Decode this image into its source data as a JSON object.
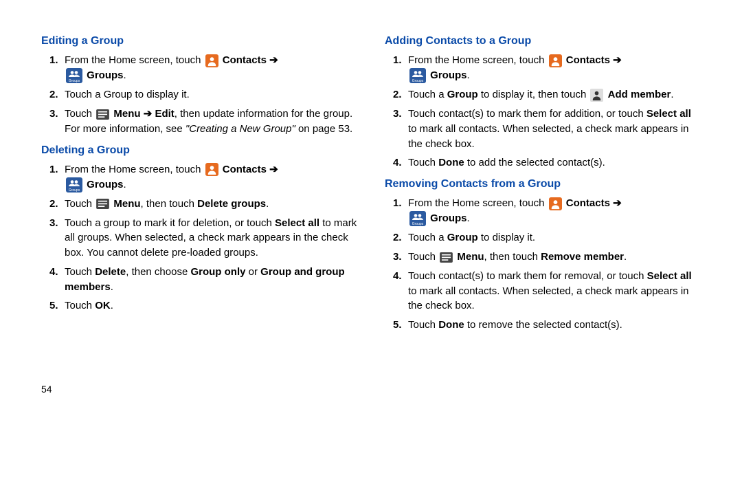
{
  "page_number": "54",
  "left": {
    "section1": {
      "heading": "Editing a Group",
      "step1_a": "From the Home screen, touch ",
      "step1_contacts": "Contacts",
      "step1_groups": "Groups",
      "step1_dot": ".",
      "step2": "Touch a Group to display it.",
      "step3_a": "Touch ",
      "step3_menu": "Menu",
      "step3_b": " ➔ ",
      "step3_edit": "Edit",
      "step3_c": ", then update information for the group. For more information, see ",
      "step3_ref": "\"Creating a New Group\"",
      "step3_d": " on page 53."
    },
    "section2": {
      "heading": "Deleting a Group",
      "step1_a": "From the Home screen, touch ",
      "step1_contacts": "Contacts",
      "step1_groups": "Groups",
      "step1_dot": ".",
      "step2_a": "Touch ",
      "step2_menu": "Menu",
      "step2_b": ", then touch ",
      "step2_del": "Delete groups",
      "step2_dot": ".",
      "step3_a": "Touch a group to mark it for deletion, or touch ",
      "step3_selall": "Select all",
      "step3_b": " to mark all groups. When selected, a check mark appears in the check box. You cannot delete pre-loaded groups.",
      "step4_a": "Touch ",
      "step4_del": "Delete",
      "step4_b": ", then choose ",
      "step4_go": "Group only",
      "step4_c": " or ",
      "step4_gm": "Group and group members",
      "step4_dot": ".",
      "step5_a": "Touch ",
      "step5_ok": "OK",
      "step5_dot": "."
    }
  },
  "right": {
    "section1": {
      "heading": "Adding Contacts to a Group",
      "step1_a": "From the Home screen, touch ",
      "step1_contacts": "Contacts",
      "step1_groups": "Groups",
      "step1_dot": ".",
      "step2_a": "Touch a ",
      "step2_group": "Group",
      "step2_b": " to display it, then touch ",
      "step2_add": "Add member",
      "step2_dot": ".",
      "step3_a": "Touch contact(s) to mark them for addition, or touch ",
      "step3_selall": "Select all",
      "step3_b": " to mark all contacts. When selected, a check mark appears in the check box.",
      "step4_a": "Touch ",
      "step4_done": "Done",
      "step4_b": " to add the selected contact(s)."
    },
    "section2": {
      "heading": "Removing Contacts from a Group",
      "step1_a": "From the Home screen, touch ",
      "step1_contacts": "Contacts",
      "step1_groups": "Groups",
      "step1_dot": ".",
      "step2_a": "Touch a ",
      "step2_group": "Group",
      "step2_b": " to display it.",
      "step3_a": "Touch ",
      "step3_menu": "Menu",
      "step3_b": ", then touch ",
      "step3_rm": "Remove member",
      "step3_dot": ".",
      "step4_a": "Touch contact(s) to mark them for removal, or touch ",
      "step4_selall": "Select all",
      "step4_b": " to mark all contacts. When selected, a check mark appears in the check box.",
      "step5_a": "Touch ",
      "step5_done": "Done",
      "step5_b": " to remove the selected contact(s)."
    }
  }
}
